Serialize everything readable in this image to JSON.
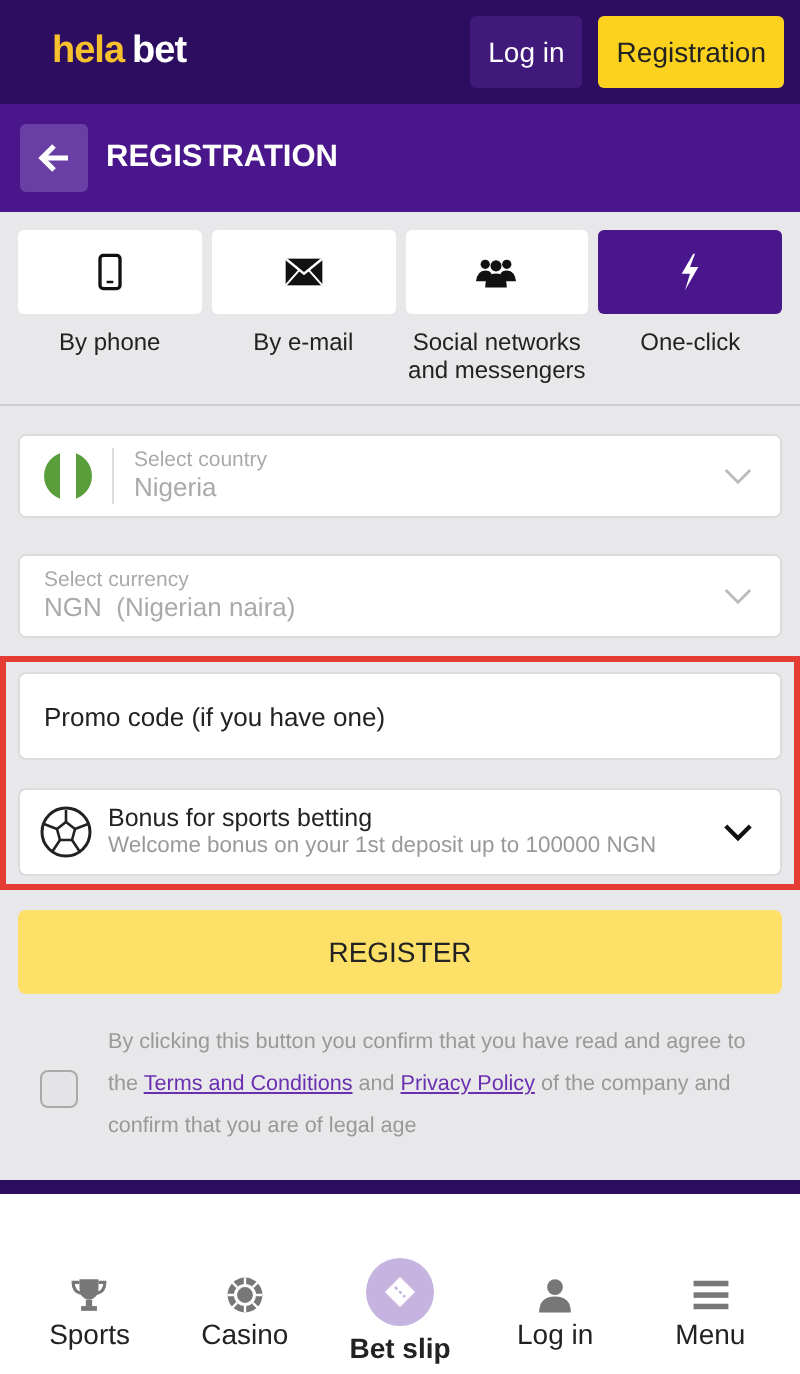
{
  "header": {
    "logo": [
      {
        "text": "hela",
        "kind": "accent"
      },
      {
        "text": "bet",
        "kind": "plain"
      }
    ],
    "buttons": [
      {
        "label": "Log in",
        "kind": "secondary"
      },
      {
        "label": "Registration",
        "kind": "primary"
      }
    ]
  },
  "page_title": "REGISTRATION",
  "methods": [
    {
      "label": "By phone",
      "kind": "phone",
      "selected": false
    },
    {
      "label": "By e-mail",
      "kind": "mail",
      "selected": false
    },
    {
      "label": "Social networks and messengers",
      "kind": "social",
      "selected": false
    },
    {
      "label": "One-click",
      "kind": "oneclick",
      "selected": true
    }
  ],
  "selects": [
    {
      "label": "Select country",
      "value": "Nigeria",
      "kind": "country"
    },
    {
      "label": "Select currency",
      "value": "NGN  (Nigerian naira)",
      "kind": "plain"
    }
  ],
  "promo": {
    "placeholder": "Promo code (if you have one)"
  },
  "bonus": {
    "title": "Bonus for sports betting",
    "subtitle": "Welcome bonus on your 1st deposit up to 100000 NGN"
  },
  "register_button": "REGISTER",
  "consent": {
    "checked": false,
    "parts": [
      {
        "kind": "text",
        "text": "By clicking this button you confirm that you have read and agree to the "
      },
      {
        "kind": "link",
        "text": "Terms and Conditions"
      },
      {
        "kind": "text",
        "text": " and "
      },
      {
        "kind": "link",
        "text": "Privacy Policy"
      },
      {
        "kind": "text",
        "text": " of the company and confirm that you are of legal age"
      }
    ]
  },
  "nav": [
    {
      "label": "Sports",
      "kind": "plain"
    },
    {
      "label": "Casino",
      "kind": "plain"
    },
    {
      "label": "Bet slip",
      "kind": "featured"
    },
    {
      "label": "Log in",
      "kind": "plain"
    },
    {
      "label": "Menu",
      "kind": "plain"
    }
  ]
}
